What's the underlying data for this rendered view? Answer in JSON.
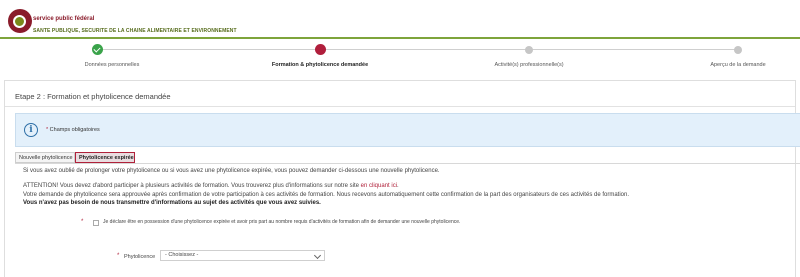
{
  "header": {
    "org_line1": "service public fédéral",
    "org_line2": "SANTE PUBLIQUE, SECURITE DE LA CHAINE ALIMENTAIRE ET ENVIRONNEMENT"
  },
  "stepper": {
    "steps": [
      {
        "label": "Données personnelles",
        "state": "done"
      },
      {
        "label": "Formation & phytolicence demandée",
        "state": "active"
      },
      {
        "label": "Activité(s) professionnelle(s)",
        "state": "pending"
      },
      {
        "label": "Aperçu de la demande",
        "state": "pending"
      }
    ]
  },
  "panel": {
    "title": "Etape 2 : Formation et phytolicence demandée",
    "required_note": "Champs obligatoires"
  },
  "tabs": [
    {
      "label": "Nouvelle phytolicence",
      "active": false
    },
    {
      "label": "Phytolicence expirée",
      "active": true
    }
  ],
  "content": {
    "intro": "Si vous avez oublié de prolonger votre phytolicence ou si vous avez une phytolicence expirée, vous pouvez demander ci-dessous une nouvelle phytolicence.",
    "attention_prefix": "ATTENTION! Vous devez d'abord participer à plusieurs activités de formation. Vous trouverez plus d'informations sur notre site ",
    "attention_link": "en cliquant ici",
    "attention_suffix": ".",
    "confirmation": "Votre demande de phytolicence sera approuvée après confirmation de votre participation à ces activités de formation. Nous recevons automatiquement cette confirmation de la part des organisateurs de ces activités de formation.",
    "bold_note": "Vous n'avez pas besoin de nous transmettre d'informations au sujet des activités que vous avez suivies."
  },
  "form": {
    "checkbox_label": "Je déclare être en possession d'une phytolicence expirée et avoir pris part au nombre requis d'activités de formation afin de demander une nouvelle phytolicence.",
    "select_label": "Phytolicence",
    "select_value": "- Choisissez -"
  },
  "colors": {
    "brand": "#8a1c2b",
    "accent_green": "#7ea43b",
    "done": "#3aa34a",
    "active": "#b01e3c",
    "info_bg": "#e3f0fb"
  }
}
